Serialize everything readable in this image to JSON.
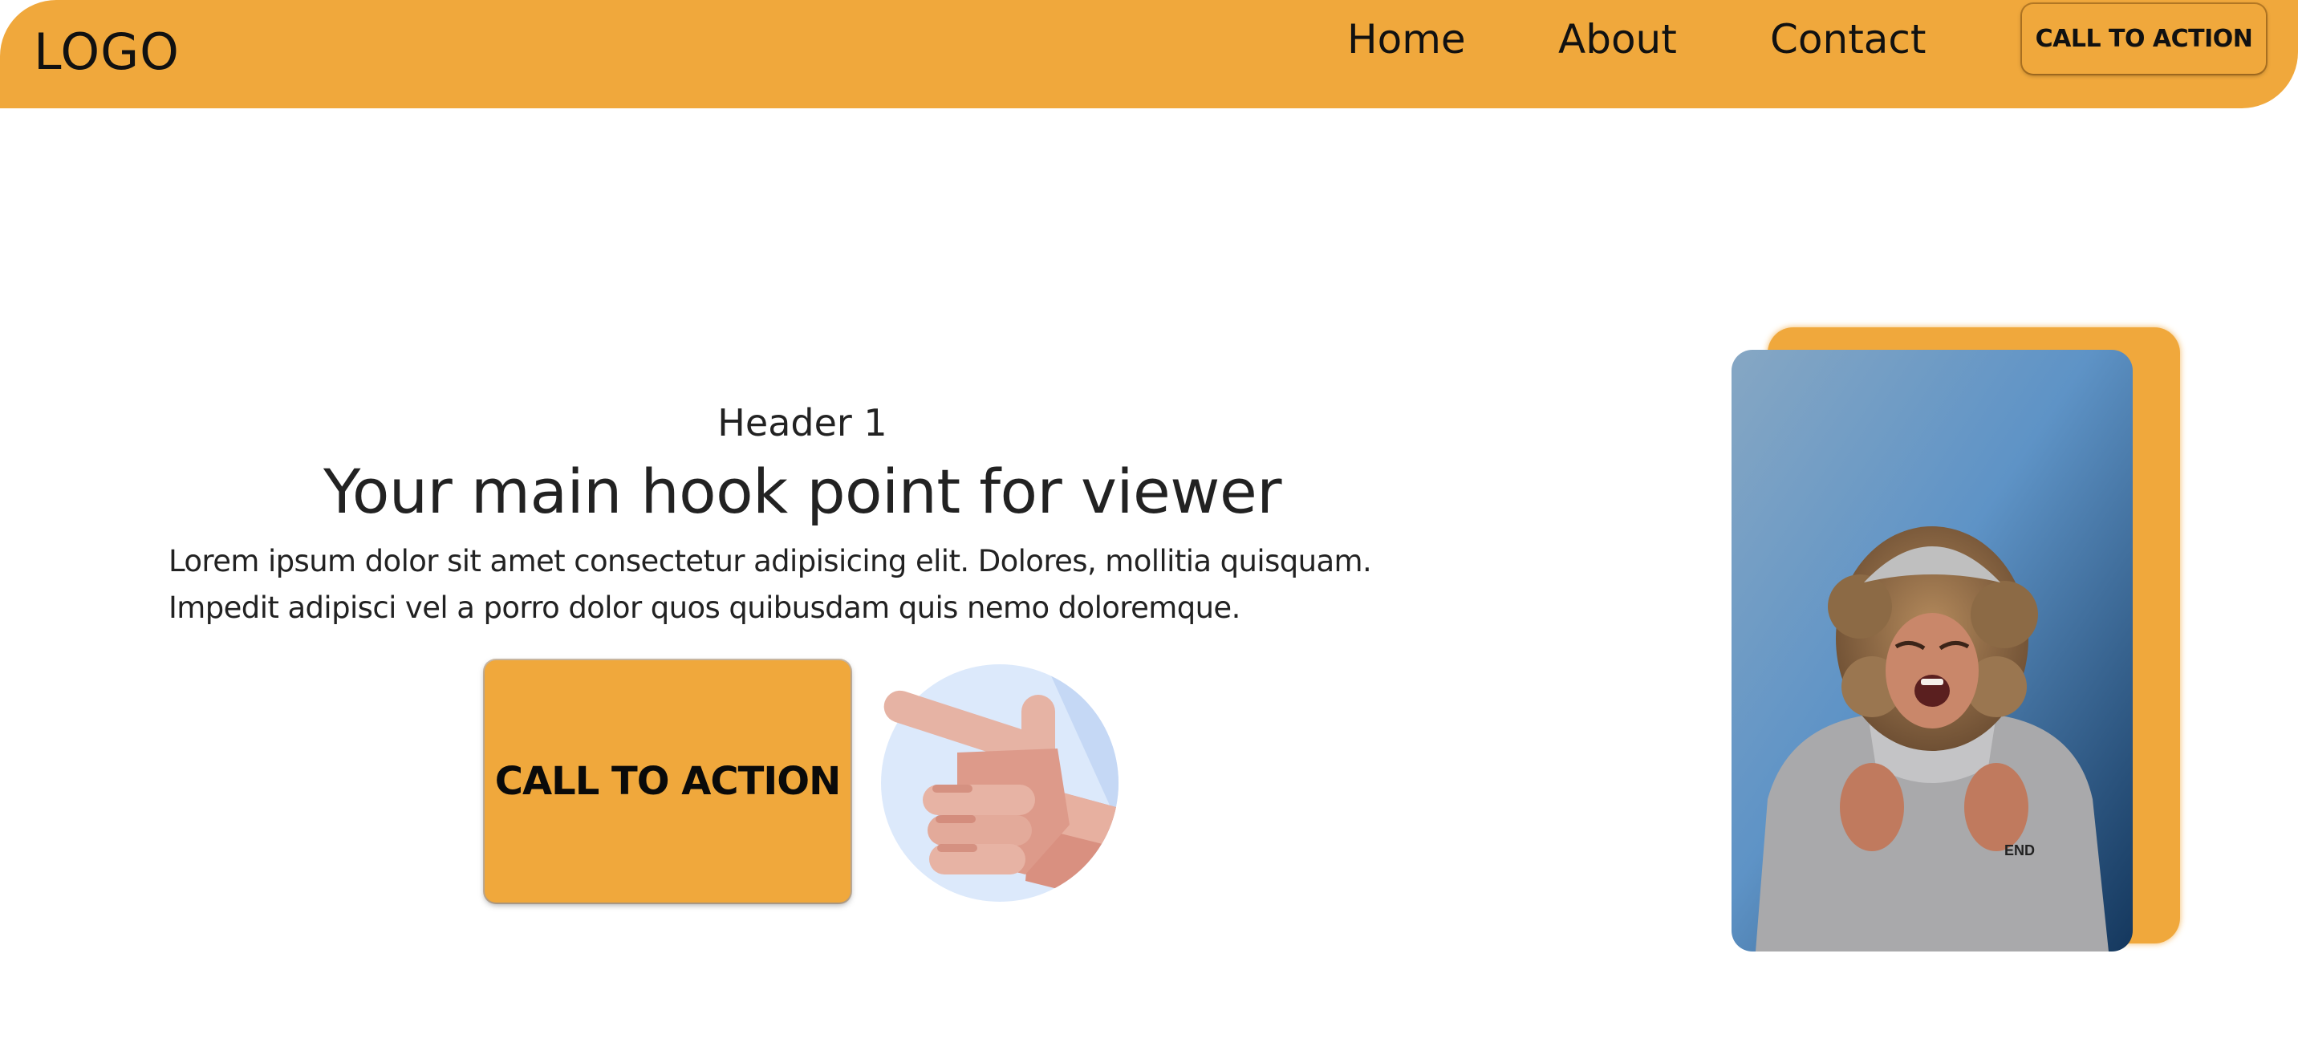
{
  "nav": {
    "logo": "LOGO",
    "links": [
      "Home",
      "About",
      "Contact"
    ],
    "cta_label": "CALL TO ACTION"
  },
  "hero": {
    "header": "Header 1",
    "hook": "Your main hook point for viewer",
    "body_lines": [
      "Lorem ipsum dolor sit amet consectetur adipisicing elit. Dolores, mollitia quisquam.",
      "Impedit adipisci vel a porro dolor quos quibusdam quis nemo doloremque."
    ],
    "cta_label": "CALL TO ACTION",
    "pointer_icon": "pointing-hand-icon",
    "photo": "smiling-person-photo"
  },
  "colors": {
    "accent": "#f0a83c",
    "text": "#212529",
    "photo_bg": "#5a8fc0",
    "icon_circle": "#dce9fb"
  }
}
